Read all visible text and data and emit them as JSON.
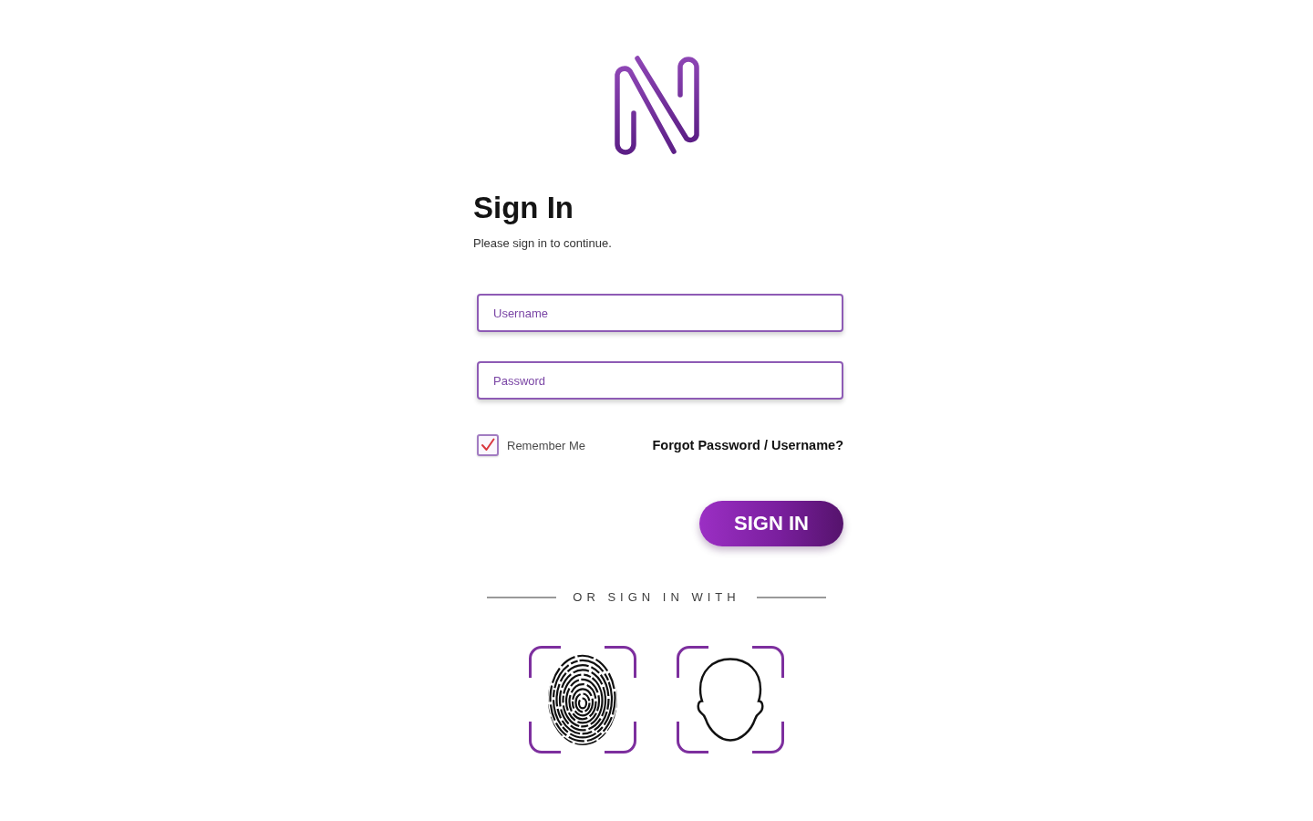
{
  "heading": {
    "title": "Sign In",
    "subtitle": "Please sign in to continue."
  },
  "form": {
    "fields": [
      {
        "placeholder": "Username"
      },
      {
        "placeholder": "Password"
      }
    ],
    "remember": {
      "label": "Remember Me",
      "checked": true
    },
    "forgot_link": "Forgot Password / Username?",
    "submit": "SIGN IN"
  },
  "alternative": {
    "label": "OR SIGN IN WITH",
    "methods": [
      {
        "kind": "fingerprint"
      },
      {
        "kind": "face"
      }
    ]
  }
}
